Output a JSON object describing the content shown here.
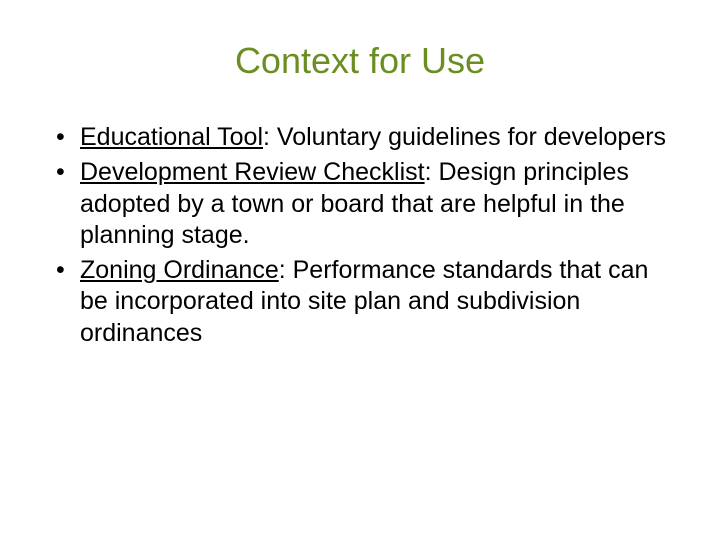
{
  "title": "Context for Use",
  "bullets": [
    {
      "term": "Educational Tool",
      "desc": ": Voluntary guidelines for developers"
    },
    {
      "term": "Development Review Checklist",
      "desc": ":  Design principles adopted by a town or board that are helpful in the planning stage."
    },
    {
      "term": "Zoning Ordinance",
      "desc": ": Performance standards that can be incorporated into site plan and subdivision ordinances"
    }
  ]
}
